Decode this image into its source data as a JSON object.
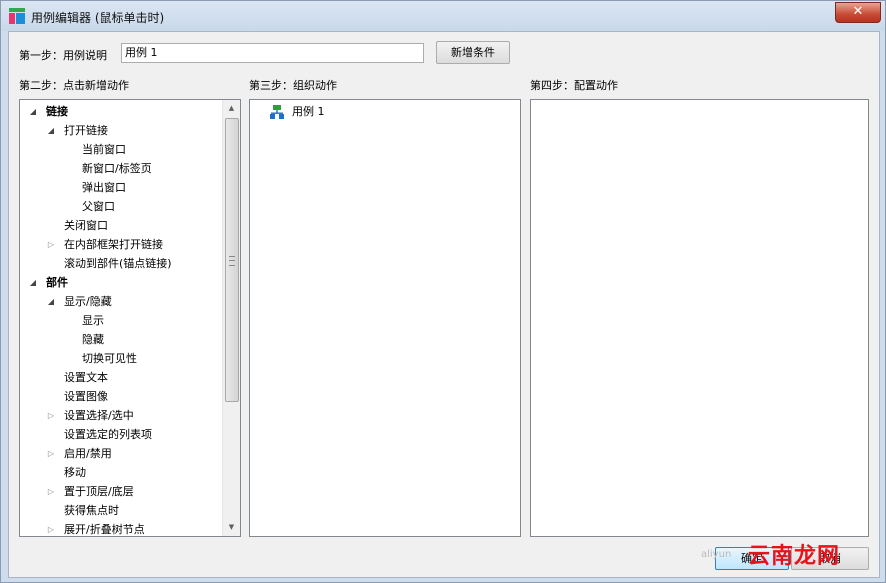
{
  "window": {
    "title": "用例编辑器 (鼠标单击时)",
    "close_label": "✕"
  },
  "step1": {
    "label": "第一步：用例说明",
    "value": "用例 1",
    "add_condition_label": "新增条件"
  },
  "step2": {
    "label": "第二步：点击新增动作"
  },
  "step3": {
    "label": "第三步：组织动作"
  },
  "step4": {
    "label": "第四步：配置动作"
  },
  "actions_tree": [
    {
      "label": "链接",
      "level": 0,
      "toggle": "expanded",
      "bold": true
    },
    {
      "label": "打开链接",
      "level": 1,
      "toggle": "expanded",
      "bold": false
    },
    {
      "label": "当前窗口",
      "level": 2,
      "toggle": "none",
      "bold": false
    },
    {
      "label": "新窗口/标签页",
      "level": 2,
      "toggle": "none",
      "bold": false
    },
    {
      "label": "弹出窗口",
      "level": 2,
      "toggle": "none",
      "bold": false
    },
    {
      "label": "父窗口",
      "level": 2,
      "toggle": "none",
      "bold": false
    },
    {
      "label": "关闭窗口",
      "level": 1,
      "toggle": "none",
      "bold": false
    },
    {
      "label": "在内部框架打开链接",
      "level": 1,
      "toggle": "collapsed",
      "bold": false
    },
    {
      "label": "滚动到部件(锚点链接)",
      "level": 1,
      "toggle": "none",
      "bold": false
    },
    {
      "label": "部件",
      "level": 0,
      "toggle": "expanded",
      "bold": true
    },
    {
      "label": "显示/隐藏",
      "level": 1,
      "toggle": "expanded",
      "bold": false
    },
    {
      "label": "显示",
      "level": 2,
      "toggle": "none",
      "bold": false
    },
    {
      "label": "隐藏",
      "level": 2,
      "toggle": "none",
      "bold": false
    },
    {
      "label": "切换可见性",
      "level": 2,
      "toggle": "none",
      "bold": false
    },
    {
      "label": "设置文本",
      "level": 1,
      "toggle": "none",
      "bold": false
    },
    {
      "label": "设置图像",
      "level": 1,
      "toggle": "none",
      "bold": false
    },
    {
      "label": "设置选择/选中",
      "level": 1,
      "toggle": "collapsed",
      "bold": false
    },
    {
      "label": "设置选定的列表项",
      "level": 1,
      "toggle": "none",
      "bold": false
    },
    {
      "label": "启用/禁用",
      "level": 1,
      "toggle": "collapsed",
      "bold": false
    },
    {
      "label": "移动",
      "level": 1,
      "toggle": "none",
      "bold": false
    },
    {
      "label": "置于顶层/底层",
      "level": 1,
      "toggle": "collapsed",
      "bold": false
    },
    {
      "label": "获得焦点时",
      "level": 1,
      "toggle": "none",
      "bold": false
    },
    {
      "label": "展开/折叠树节点",
      "level": 1,
      "toggle": "collapsed",
      "bold": false
    }
  ],
  "organize": {
    "case_label": "用例 1",
    "case_icon": "case-flow-icon"
  },
  "buttons": {
    "ok_label": "确定",
    "cancel_label": "取消"
  },
  "watermark": {
    "text": "云南龙网",
    "small": "aliyun"
  },
  "colors": {
    "case_icon_green": "#2e9e3e",
    "case_icon_blue": "#1e6fc8",
    "watermark_red": "#e8131a"
  }
}
